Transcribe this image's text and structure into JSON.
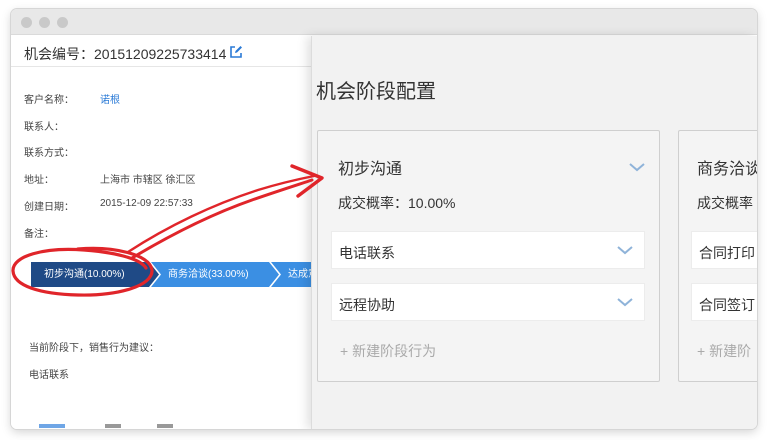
{
  "left": {
    "opportunity_title": "机会编号：20151209225733414",
    "fields": [
      {
        "label": "客户名称：",
        "value": "诺根",
        "link": true
      },
      {
        "label": "联系人：",
        "value": ""
      },
      {
        "label": "联系方式：",
        "value": ""
      },
      {
        "label": "地址：",
        "value": "上海市 市辖区 徐汇区"
      },
      {
        "label": "创建日期：",
        "value": "2015-12-09 22:57:33"
      },
      {
        "label": "备注：",
        "value": ""
      }
    ],
    "stages": [
      {
        "label": "初步沟通(10.00%)"
      },
      {
        "label": "商务洽谈(33.00%)"
      },
      {
        "label": "达成意向"
      }
    ],
    "advice_label": "当前阶段下，销售行为建议：",
    "advice_action": "电话联系"
  },
  "right": {
    "title": "机会阶段配置",
    "cards": [
      {
        "title": "初步沟通",
        "rate": "成交概率：10.00%",
        "actions": [
          "电话联系",
          "远程协助"
        ],
        "new_action": "+ 新建阶段行为"
      },
      {
        "title": "商务洽谈",
        "rate": "成交概率",
        "actions": [
          "合同打印",
          "合同签订"
        ],
        "new_action": "+ 新建阶"
      }
    ]
  },
  "colors": {
    "accent": "#3b8fe3",
    "active_stage": "#1f4a86",
    "link": "#2a7ad6",
    "annotation": "#e0252a",
    "chevron": "#8fb3d9"
  },
  "icons": {
    "edit": "edit-icon",
    "expand": "chevron-down-icon"
  }
}
